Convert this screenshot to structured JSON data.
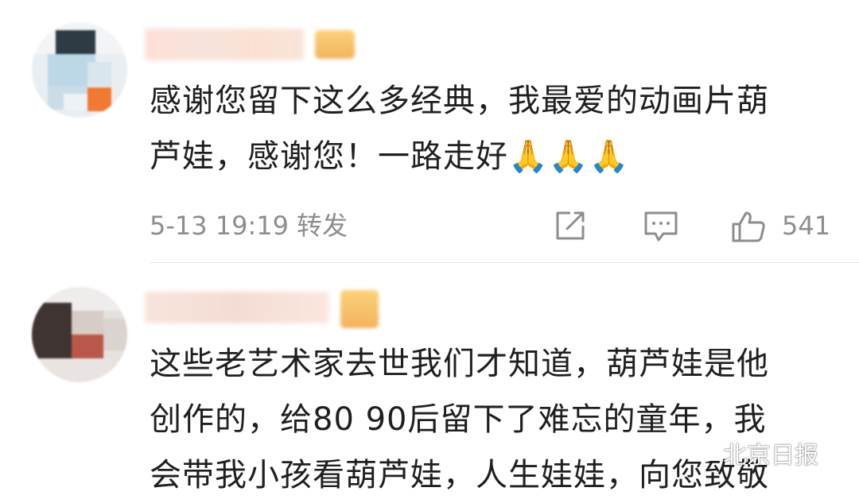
{
  "comments": [
    {
      "text_lines": [
        "感谢您留下这么多经典，我最爱的动画片葫",
        "芦娃，感谢您！一路走好🙏🙏🙏"
      ],
      "timestamp": "5-13 19:19",
      "repost_label": "转发",
      "like_count": "541"
    },
    {
      "text_lines": [
        "这些老艺术家去世我们才知道，葫芦娃是他",
        "创作的，给80 90后留下了难忘的童年，我",
        "会带我小孩看葫芦娃，人生娃娃，向您致敬"
      ]
    }
  ],
  "watermark": {
    "text": "北京日报"
  },
  "icons": {
    "share": "share-icon",
    "comment": "comment-icon",
    "like": "thumbs-up-icon",
    "watermark": "weibo-logo-icon"
  },
  "colors": {
    "text": "#1f1f1f",
    "meta": "#8d8d8d",
    "divider": "#e5e5e5",
    "background": "#ffffff"
  }
}
